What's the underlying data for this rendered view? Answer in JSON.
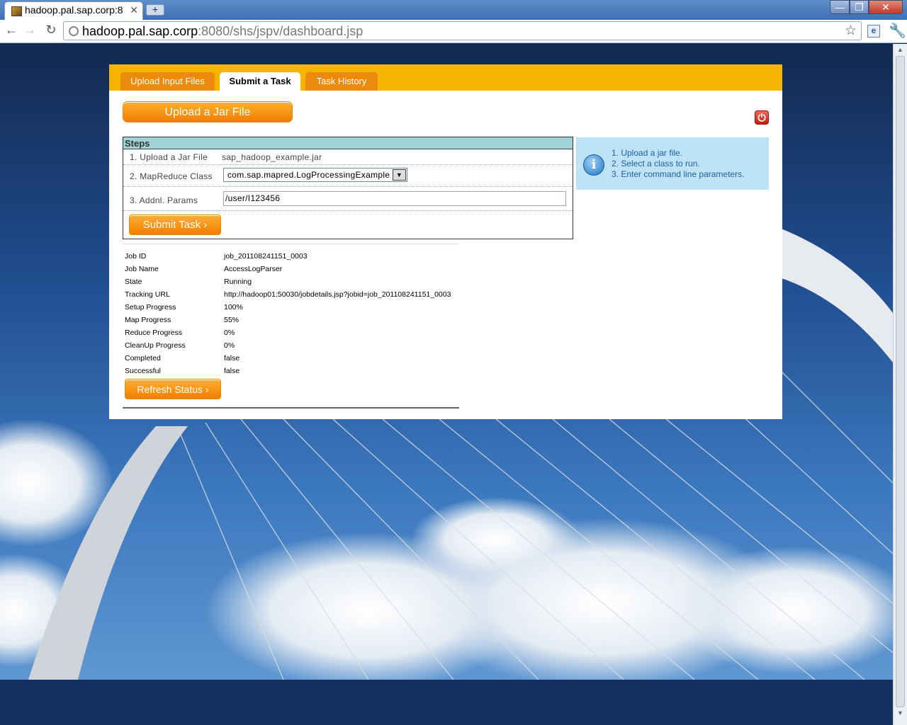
{
  "browser": {
    "tab_title": "hadoop.pal.sap.corp:8",
    "tab_close": "✕",
    "new_tab": "+",
    "url_host": "hadoop.pal.sap.corp",
    "url_rest": ":8080/shs/jspv/dashboard.jsp",
    "window_controls": {
      "minimize": "—",
      "maximize": "❐",
      "close": "✕"
    }
  },
  "app": {
    "tabs": [
      {
        "label": "Upload Input Files",
        "active": false
      },
      {
        "label": "Submit a Task",
        "active": true
      },
      {
        "label": "Task History",
        "active": false
      }
    ],
    "upload_jar_button": "Upload a Jar File",
    "power_icon": "power-icon",
    "steps": {
      "header": "Steps",
      "step1_label": "1. Upload a Jar File",
      "step1_value": "sap_hadoop_example.jar",
      "step2_label": "2. MapReduce Class",
      "step2_value": "com.sap.mapred.LogProcessingExample",
      "step3_label": "3. Addnl. Params",
      "step3_value": "/user/I123456",
      "submit_button": "Submit Task ›"
    },
    "info": {
      "icon": "info-icon",
      "items": [
        "1. Upload a jar file.",
        "2. Select a class to run.",
        "3. Enter command line parameters."
      ]
    },
    "job": {
      "rows": [
        {
          "key": "Job ID",
          "value": "job_201108241151_0003"
        },
        {
          "key": "Job Name",
          "value": "AccessLogParser"
        },
        {
          "key": "State",
          "value": "Running"
        },
        {
          "key": "Tracking URL",
          "value": "http://hadoop01:50030/jobdetails.jsp?jobid=job_201108241151_0003"
        },
        {
          "key": "Setup Progress",
          "value": "100%"
        },
        {
          "key": "Map Progress",
          "value": "55%"
        },
        {
          "key": "Reduce Progress",
          "value": "0%"
        },
        {
          "key": "CleanUp Progress",
          "value": "0%"
        },
        {
          "key": "Completed",
          "value": "false"
        },
        {
          "key": "Successful",
          "value": "false"
        }
      ],
      "refresh_button": "Refresh Status ›"
    }
  }
}
